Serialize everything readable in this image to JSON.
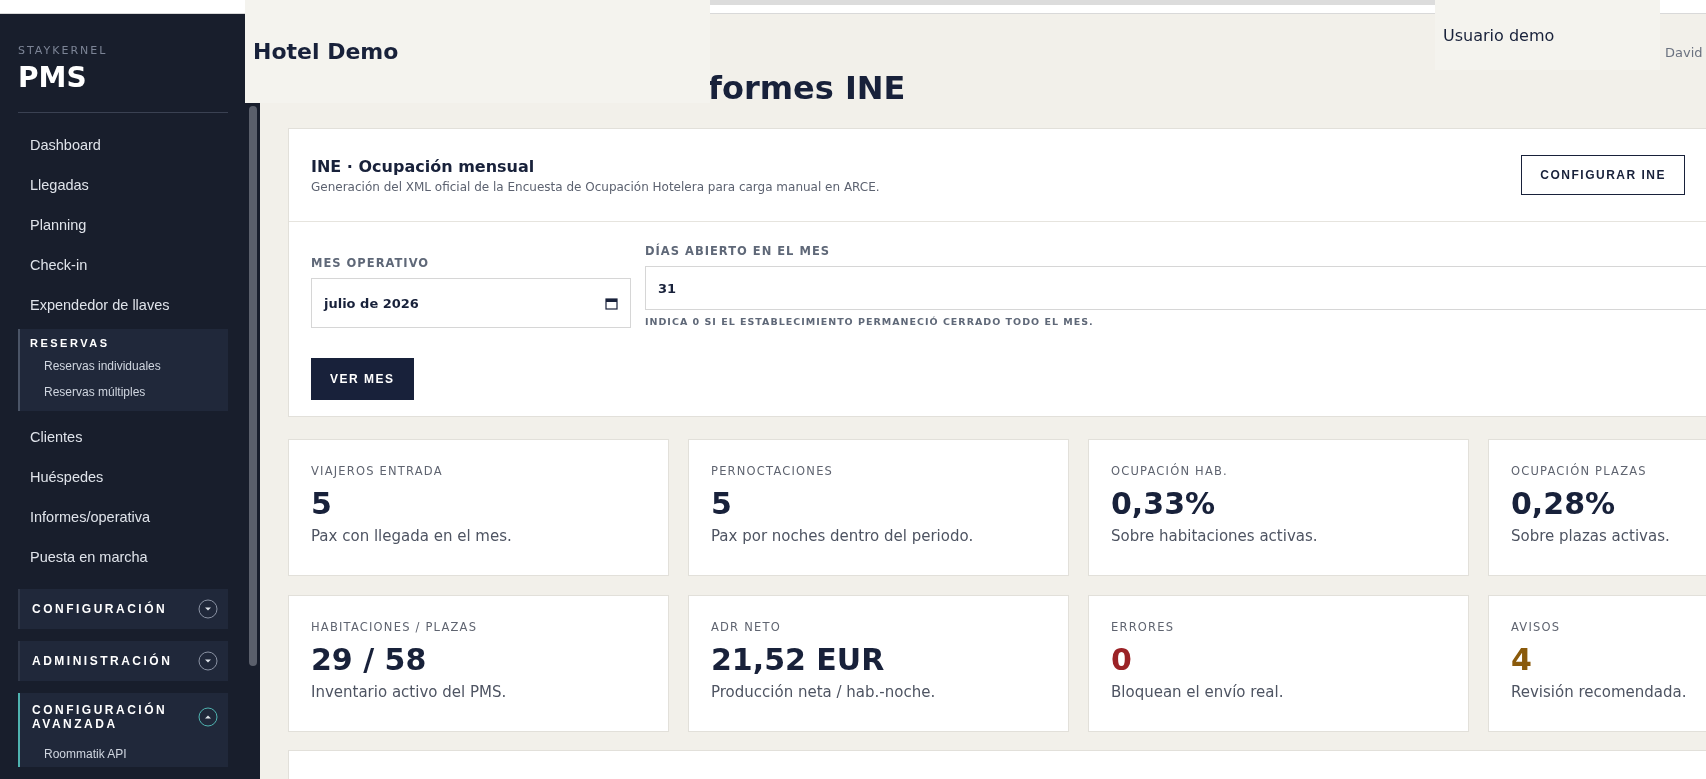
{
  "brand": {
    "eyebrow": "STAYKERNEL",
    "title": "PMS"
  },
  "sidebar": {
    "items": [
      {
        "kind": "link",
        "label": "Dashboard"
      },
      {
        "kind": "link",
        "label": "Llegadas"
      },
      {
        "kind": "link",
        "label": "Planning"
      },
      {
        "kind": "link",
        "label": "Check-in"
      },
      {
        "kind": "link",
        "label": "Expendedor de llaves"
      },
      {
        "kind": "section",
        "label": "RESERVAS",
        "children": [
          {
            "label": "Reservas individuales"
          },
          {
            "label": "Reservas múltiples"
          }
        ]
      },
      {
        "kind": "link",
        "label": "Clientes"
      },
      {
        "kind": "link",
        "label": "Huéspedes"
      },
      {
        "kind": "link",
        "label": "Informes/operativa"
      },
      {
        "kind": "link",
        "label": "Puesta en marcha"
      },
      {
        "kind": "group",
        "label": "CONFIGURACIÓN",
        "expanded": false
      },
      {
        "kind": "group",
        "label": "ADMINISTRACIÓN",
        "expanded": false
      },
      {
        "kind": "group",
        "label": "CONFIGURACIÓN AVANZADA",
        "expanded": true,
        "children": [
          {
            "label": "Roommatik API"
          }
        ]
      }
    ]
  },
  "header": {
    "hotel": "Hotel Demo",
    "user": "Usuario demo",
    "user_name": "David"
  },
  "page_title": "formes INE",
  "panel": {
    "title": "INE · Ocupación mensual",
    "subtitle": "Generación del XML oficial de la Encuesta de Ocupación Hotelera para carga manual en ARCE.",
    "buttons": [
      "CONFIGURAR INE"
    ],
    "month": {
      "label": "MES OPERATIVO",
      "value": "julio de 2026"
    },
    "days": {
      "label": "DÍAS ABIERTO EN EL MES",
      "value": "31",
      "hint": "INDICA 0 SI EL ESTABLECIMIENTO PERMANECIÓ CERRADO TODO EL MES."
    },
    "submit": "VER MES"
  },
  "stats": [
    {
      "label": "VIAJEROS ENTRADA",
      "value": "5",
      "note": "Pax con llegada en el mes.",
      "color": "#18213a"
    },
    {
      "label": "PERNOCTACIONES",
      "value": "5",
      "note": "Pax por noches dentro del periodo.",
      "color": "#18213a"
    },
    {
      "label": "OCUPACIÓN HAB.",
      "value": "0,33%",
      "note": "Sobre habitaciones activas.",
      "color": "#18213a"
    },
    {
      "label": "OCUPACIÓN PLAZAS",
      "value": "0,28%",
      "note": "Sobre plazas activas.",
      "color": "#18213a"
    },
    {
      "label": "HABITACIONES / PLAZAS",
      "value": "29 / 58",
      "note": "Inventario activo del PMS.",
      "color": "#18213a"
    },
    {
      "label": "ADR NETO",
      "value": "21,52 EUR",
      "note": "Producción neta / hab.-noche.",
      "color": "#18213a"
    },
    {
      "label": "ERRORES",
      "value": "0",
      "note": "Bloquean el envío real.",
      "color": "#9b2226"
    },
    {
      "label": "AVISOS",
      "value": "4",
      "note": "Revisión recomendada.",
      "color": "#8a5a0b"
    }
  ]
}
